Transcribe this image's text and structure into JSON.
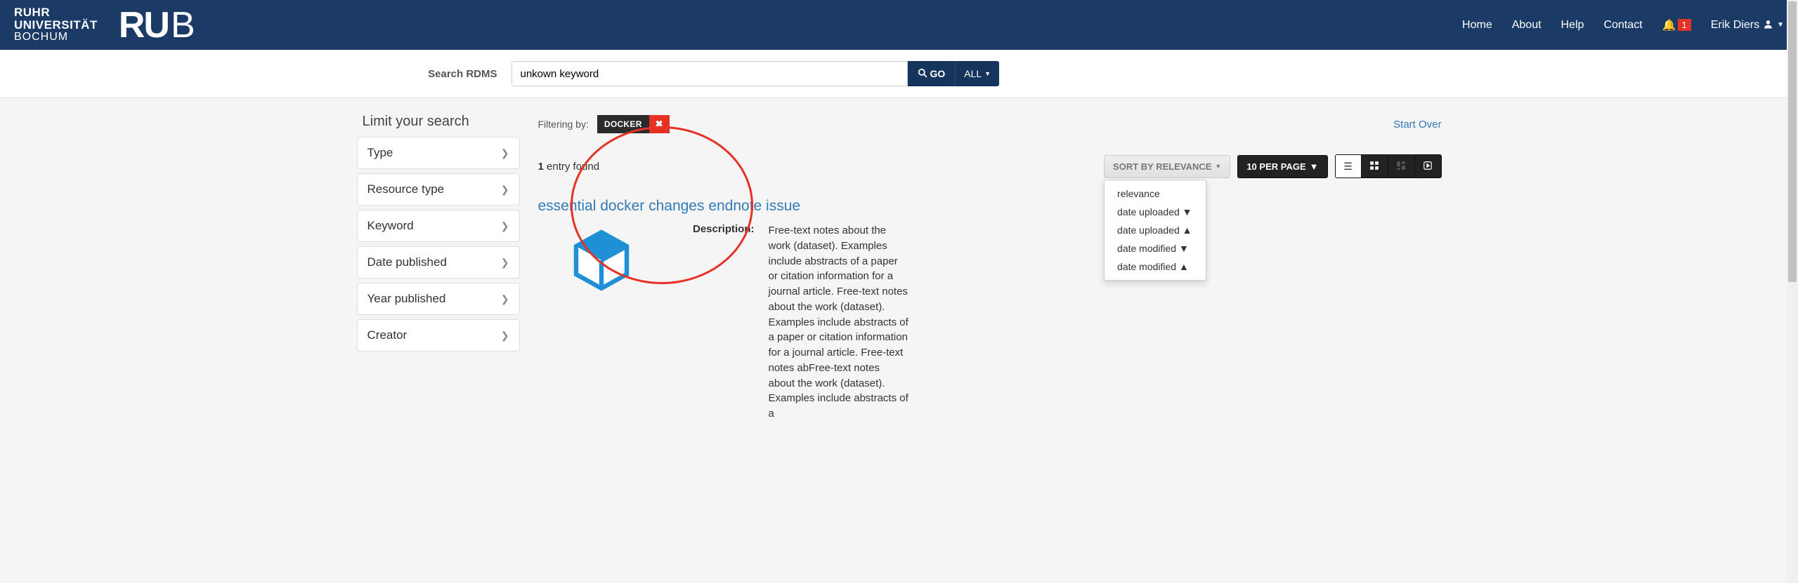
{
  "brand": {
    "line1": "RUHR",
    "line2": "UNIVERSITÄT",
    "line3": "BOCHUM",
    "logo_ru": "RU",
    "logo_b": "B"
  },
  "nav": {
    "home": "Home",
    "about": "About",
    "help": "Help",
    "contact": "Contact",
    "notif_count": "1",
    "user_name": "Erik Diers"
  },
  "search": {
    "label": "Search RDMS",
    "value": "unkown keyword",
    "go": "GO",
    "all": "ALL"
  },
  "sidebar": {
    "heading": "Limit your search",
    "facets": [
      "Type",
      "Resource type",
      "Keyword",
      "Date published",
      "Year published",
      "Creator"
    ]
  },
  "filter": {
    "label": "Filtering by:",
    "chip": "DOCKER",
    "start_over": "Start Over"
  },
  "controls": {
    "entries_count": "1",
    "entries_suffix": " entry found",
    "sort_label": "SORT BY RELEVANCE",
    "per_page": "10 PER PAGE",
    "sort_options": [
      "relevance",
      "date uploaded ▼",
      "date uploaded ▲",
      "date modified ▼",
      "date modified ▲"
    ]
  },
  "result": {
    "title": "essential docker changes endnote issue",
    "description_label": "Description:",
    "description_text": "Free-text notes about the work (dataset). Examples include abstracts of a paper or citation information for a journal article. Free-text notes about the work (dataset). Examples include abstracts of a paper or citation information for a journal article. Free-text notes abFree-text notes about the work (dataset). Examples include abstracts of a"
  }
}
